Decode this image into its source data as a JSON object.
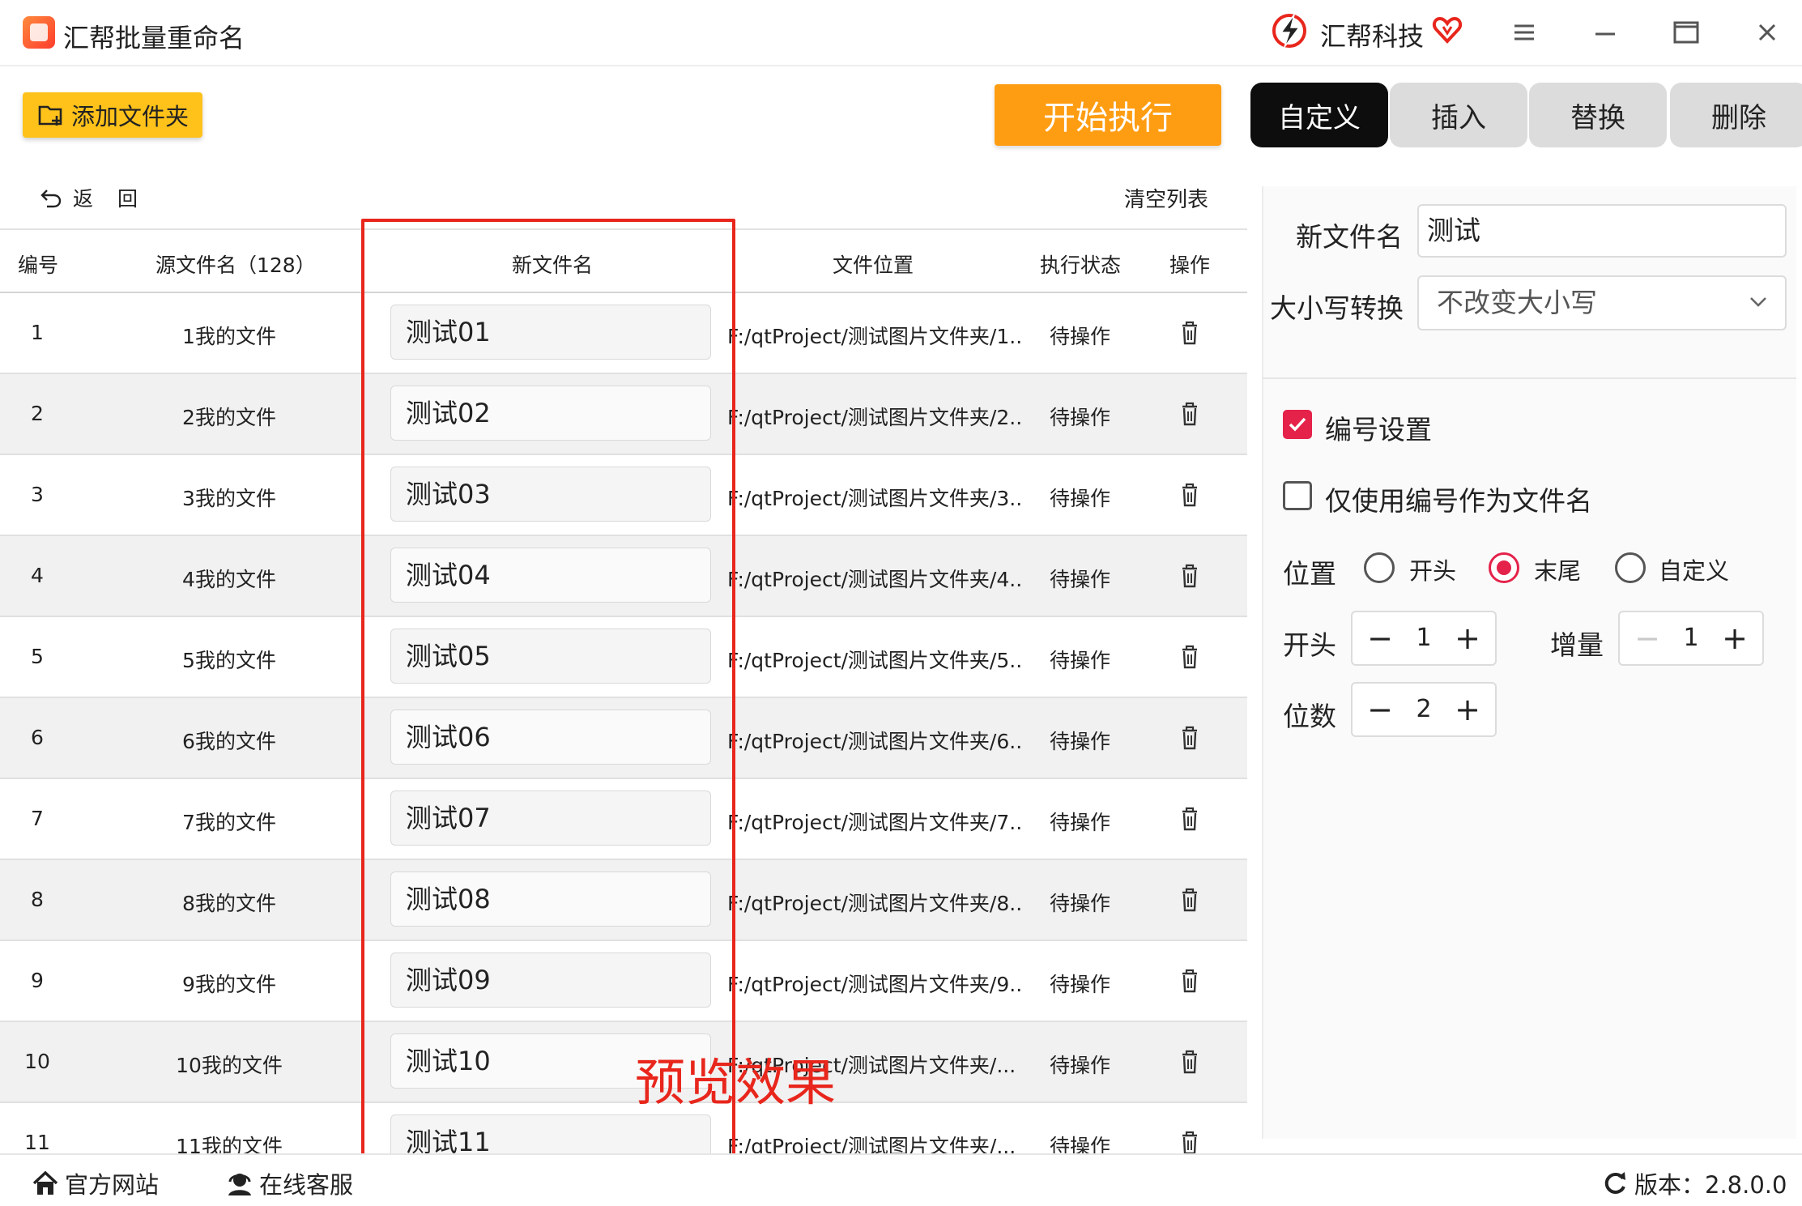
{
  "app": {
    "title": "汇帮批量重命名",
    "brand": "汇帮科技"
  },
  "toolbar": {
    "add_folder": "添加文件夹",
    "start": "开始执行"
  },
  "tabs": [
    {
      "label": "自定义",
      "active": true
    },
    {
      "label": "插入",
      "active": false
    },
    {
      "label": "替换",
      "active": false
    },
    {
      "label": "删除",
      "active": false
    }
  ],
  "list": {
    "back": "返回",
    "clear": "清空列表",
    "headers": {
      "num": "编号",
      "source": "源文件名（128）",
      "newname": "新文件名",
      "path": "文件位置",
      "status": "执行状态",
      "action": "操作"
    },
    "rows": [
      {
        "num": "1",
        "source": "1我的文件",
        "newname": "测试01",
        "path": "F:/qtProject/测试图片文件夹/1...",
        "status": "待操作"
      },
      {
        "num": "2",
        "source": "2我的文件",
        "newname": "测试02",
        "path": "F:/qtProject/测试图片文件夹/2...",
        "status": "待操作"
      },
      {
        "num": "3",
        "source": "3我的文件",
        "newname": "测试03",
        "path": "F:/qtProject/测试图片文件夹/3...",
        "status": "待操作"
      },
      {
        "num": "4",
        "source": "4我的文件",
        "newname": "测试04",
        "path": "F:/qtProject/测试图片文件夹/4...",
        "status": "待操作"
      },
      {
        "num": "5",
        "source": "5我的文件",
        "newname": "测试05",
        "path": "F:/qtProject/测试图片文件夹/5...",
        "status": "待操作"
      },
      {
        "num": "6",
        "source": "6我的文件",
        "newname": "测试06",
        "path": "F:/qtProject/测试图片文件夹/6...",
        "status": "待操作"
      },
      {
        "num": "7",
        "source": "7我的文件",
        "newname": "测试07",
        "path": "F:/qtProject/测试图片文件夹/7...",
        "status": "待操作"
      },
      {
        "num": "8",
        "source": "8我的文件",
        "newname": "测试08",
        "path": "F:/qtProject/测试图片文件夹/8...",
        "status": "待操作"
      },
      {
        "num": "9",
        "source": "9我的文件",
        "newname": "测试09",
        "path": "F:/qtProject/测试图片文件夹/9...",
        "status": "待操作"
      },
      {
        "num": "10",
        "source": "10我的文件",
        "newname": "测试10",
        "path": "F:/qtProject/测试图片文件夹/...",
        "status": "待操作"
      },
      {
        "num": "11",
        "source": "11我的文件",
        "newname": "测试11",
        "path": "F:/qtProject/测试图片文件夹/...",
        "status": "待操作"
      }
    ]
  },
  "annotation": {
    "label": "预览效果",
    "color": "#e8261c"
  },
  "settings": {
    "newname_label": "新文件名",
    "newname_value": "测试",
    "case_label": "大小写转换",
    "case_value": "不改变大小写",
    "numbering_label": "编号设置",
    "numbering_checked": true,
    "only_number_label": "仅使用编号作为文件名",
    "only_number_checked": false,
    "position_label": "位置",
    "position_options": [
      "开头",
      "末尾",
      "自定义"
    ],
    "position_selected": "末尾",
    "start_label": "开头",
    "start_value": "1",
    "increment_label": "增量",
    "increment_value": "1",
    "digits_label": "位数",
    "digits_value": "2"
  },
  "statusbar": {
    "website": "官方网站",
    "support": "在线客服",
    "version": "版本：2.8.0.0"
  },
  "colors": {
    "accent": "#e4224a",
    "start_button": "#ff9d12",
    "add_folder_button": "#ffc21a"
  }
}
